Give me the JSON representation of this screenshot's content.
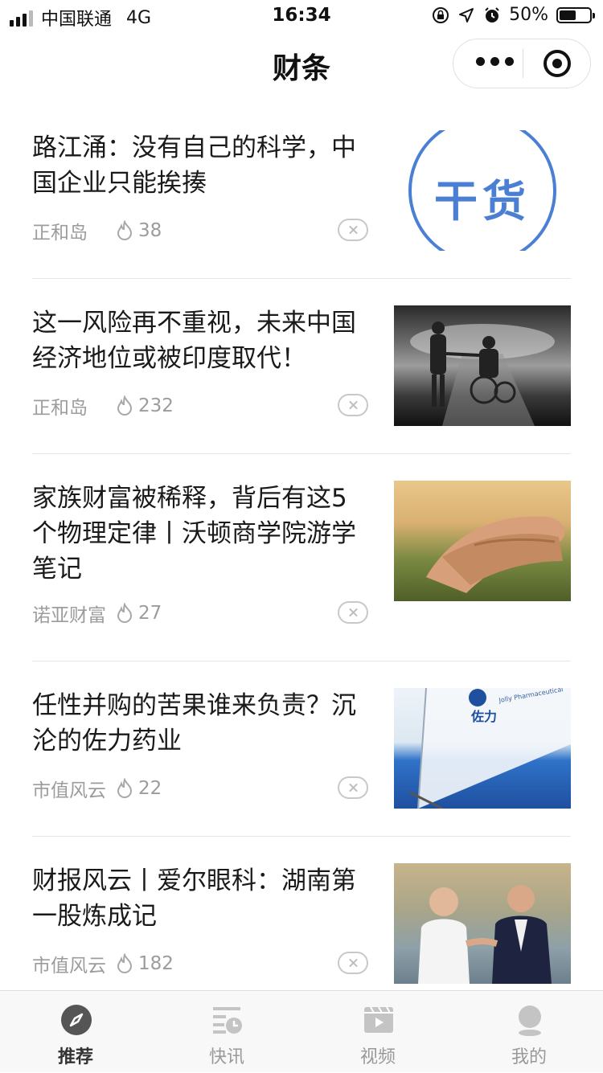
{
  "status_bar": {
    "carrier": "中国联通",
    "network": "4G",
    "time": "16:34",
    "battery_percent": "50%",
    "battery_level": 0.5
  },
  "nav": {
    "title": "财条"
  },
  "articles": [
    {
      "title": "路江涌：没有自己的科学，中国企业只能挨揍",
      "source": "正和岛",
      "heat": "38",
      "thumb_text": "干货"
    },
    {
      "title": "这一风险再不重视，未来中国经济地位或被印度取代！",
      "source": "正和岛",
      "heat": "232"
    },
    {
      "title": "家族财富被稀释，背后有这5个物理定律丨沃顿商学院游学笔记",
      "source": "诺亚财富",
      "heat": "27"
    },
    {
      "title": "任性并购的苦果谁来负责？沉沦的佐力药业",
      "source": "市值风云",
      "heat": "22",
      "thumb_text": "佐力",
      "thumb_subtext": "Jolly Pharmaceutical"
    },
    {
      "title": "财报风云丨爱尔眼科：湖南第一股炼成记",
      "source": "市值风云",
      "heat": "182"
    }
  ],
  "tabs": [
    {
      "label": "推荐",
      "icon": "compass-icon",
      "active": true
    },
    {
      "label": "快讯",
      "icon": "news-clock-icon",
      "active": false
    },
    {
      "label": "视频",
      "icon": "video-icon",
      "active": false
    },
    {
      "label": "我的",
      "icon": "profile-icon",
      "active": false
    }
  ],
  "colors": {
    "accent_blue": "#4a7fd4",
    "meta_gray": "#9c9c9c",
    "active_tab": "#333333",
    "inactive_tab": "#999999"
  }
}
